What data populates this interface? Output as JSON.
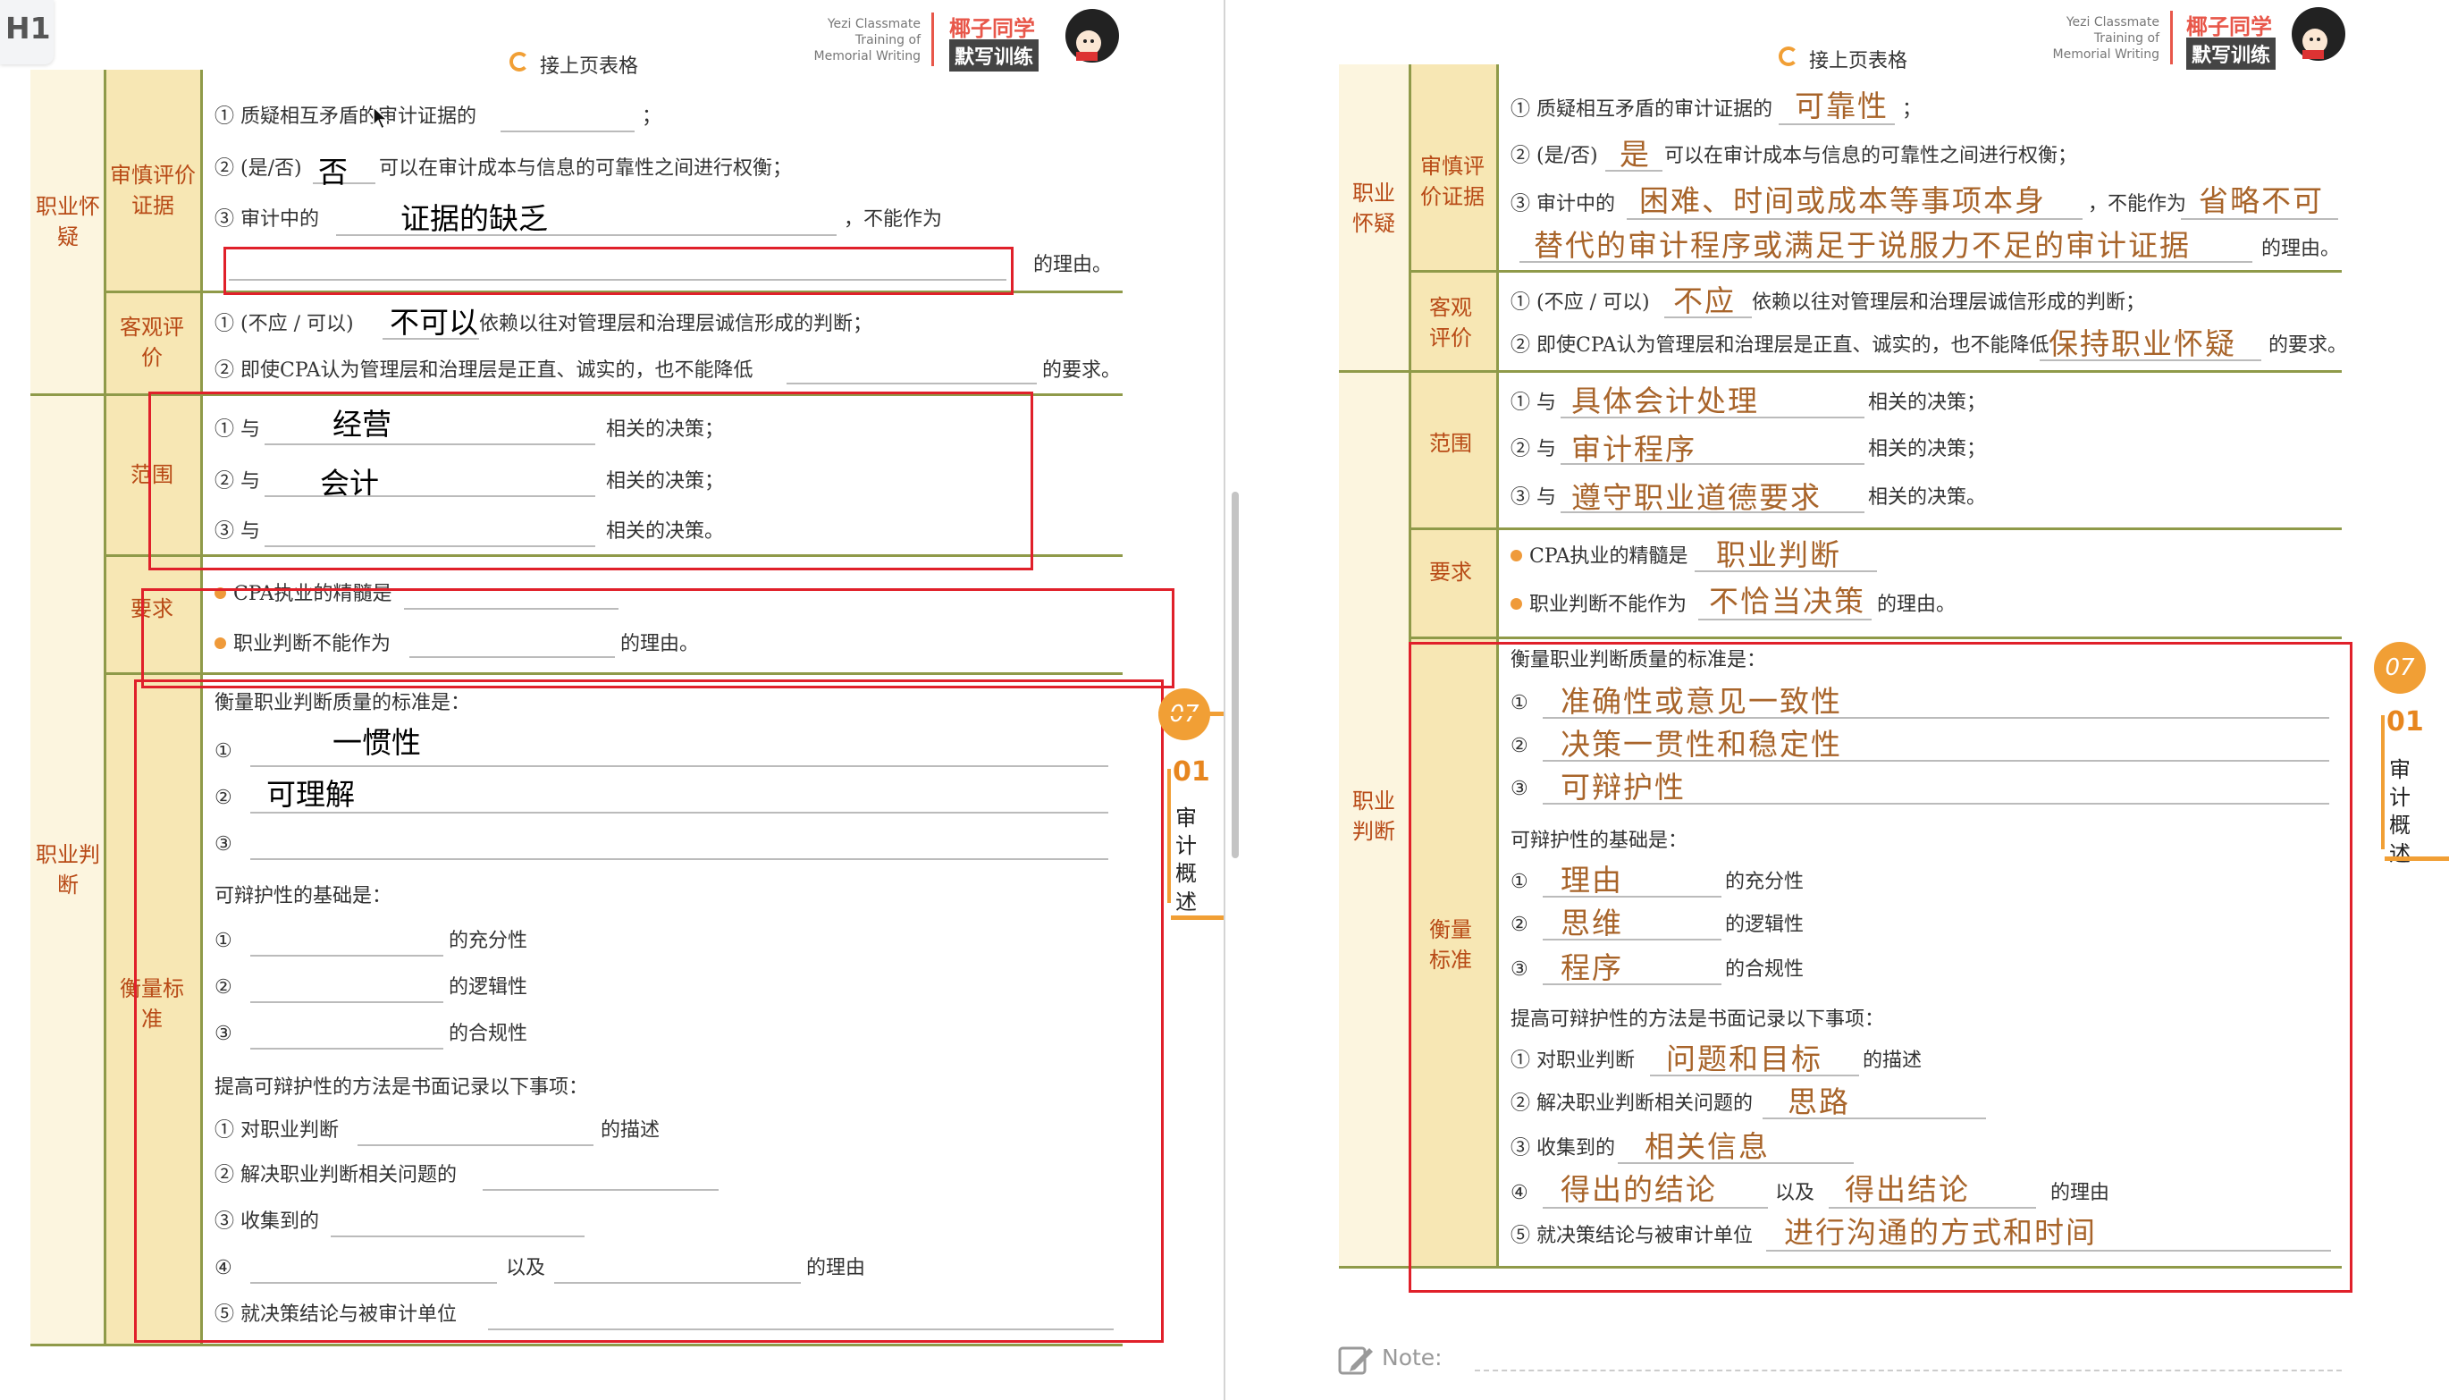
{
  "tag": "H1",
  "header": {
    "brand_en": [
      "Yezi Classmate",
      "Training of",
      "Memorial Writing"
    ],
    "brand_cn_top": "椰子同学",
    "brand_cn_bottom": "默写训练",
    "continue_label": "接上页表格",
    "note_label": "Note:"
  },
  "sidebar_tab": {
    "number": "07",
    "sub": "01",
    "chars": [
      "审",
      "计",
      "概",
      "述"
    ]
  },
  "sections": {
    "prof_skepticism": "职业怀疑",
    "prudent_eval": "审慎评价证据",
    "objective_eval": "客观评价",
    "scope": "范围",
    "requirement": "要求",
    "prof_judgment": "职业判断",
    "measure_std": "衡量标准"
  },
  "left": {
    "q1_prefix": "① 质疑相互矛盾的审计证据的",
    "q1_suffix": "；",
    "q2_prefix": "② (是/否)",
    "q2_answer": "否",
    "q2_suffix": "可以在审计成本与信息的可靠性之间进行权衡；",
    "q3_prefix": "③ 审计中的",
    "q3_answer": "证据的缺乏",
    "q3_mid": "，不能作为",
    "q3_suffix": "的理由。",
    "obj1_prefix": "① (不应 / 可以)",
    "obj1_answer": "不可以",
    "obj1_suffix": "依赖以往对管理层和治理层诚信形成的判断；",
    "obj2_prefix": "② 即使CPA认为管理层和治理层是正直、诚实的，也不能降低",
    "obj2_suffix": "的要求。",
    "scope1_prefix": "① 与",
    "scope1_answer": "经营",
    "scope1_suffix": "相关的决策；",
    "scope2_prefix": "② 与",
    "scope2_answer": "会计",
    "scope2_suffix": "相关的决策；",
    "scope3_prefix": "③ 与",
    "scope3_suffix": "相关的决策。",
    "req1": "CPA执业的精髓是",
    "req2_prefix": "职业判断不能作为",
    "req2_suffix": "的理由。",
    "std_title": "衡量职业判断质量的标准是：",
    "std1_num": "①",
    "std1_answer": "一惯性",
    "std2_num": "②",
    "std2_answer": "可理解",
    "std3_num": "③",
    "def_title": "可辩护性的基础是：",
    "def1_num": "①",
    "def1_suffix": "的充分性",
    "def2_num": "②",
    "def2_suffix": "的逻辑性",
    "def3_num": "③",
    "def3_suffix": "的合规性",
    "rec_title": "提高可辩护性的方法是书面记录以下事项：",
    "rec1_prefix": "① 对职业判断",
    "rec1_suffix": "的描述",
    "rec2_prefix": "② 解决职业判断相关问题的",
    "rec3_prefix": "③ 收集到的",
    "rec4_num": "④",
    "rec4_mid": "以及",
    "rec4_suffix": "的理由",
    "rec5_prefix": "⑤ 就决策结论与被审计单位"
  },
  "right": {
    "q1_prefix": "① 质疑相互矛盾的审计证据的",
    "q1_answer": "可靠性",
    "q1_suffix": "；",
    "q2_prefix": "② (是/否)",
    "q2_answer": "是",
    "q2_suffix": "可以在审计成本与信息的可靠性之间进行权衡；",
    "q3_prefix": "③ 审计中的",
    "q3_answer": "困难、时间或成本等事项本身",
    "q3_mid": "，不能作为",
    "q3_answer2": "省略不可",
    "q3_answer3": "替代的审计程序或满足于说服力不足的审计证据",
    "q3_suffix": "的理由。",
    "obj1_prefix": "① (不应 / 可以)",
    "obj1_answer": "不应",
    "obj1_suffix": "依赖以往对管理层和治理层诚信形成的判断；",
    "obj2_prefix": "② 即使CPA认为管理层和治理层是正直、诚实的，也不能降低",
    "obj2_answer": "保持职业怀疑",
    "obj2_suffix": "的要求。",
    "scope1_prefix": "① 与",
    "scope1_answer": "具体会计处理",
    "scope1_suffix": "相关的决策；",
    "scope2_prefix": "② 与",
    "scope2_answer": "审计程序",
    "scope2_suffix": "相关的决策；",
    "scope3_prefix": "③ 与",
    "scope3_answer": "遵守职业道德要求",
    "scope3_suffix": "相关的决策。",
    "req1": "CPA执业的精髓是",
    "req1_answer": "职业判断",
    "req2_prefix": "职业判断不能作为",
    "req2_answer": "不恰当决策",
    "req2_suffix": "的理由。",
    "std_title": "衡量职业判断质量的标准是：",
    "std1_num": "①",
    "std1_answer": "准确性或意见一致性",
    "std2_num": "②",
    "std2_answer": "决策一贯性和稳定性",
    "std3_num": "③",
    "std3_answer": "可辩护性",
    "def_title": "可辩护性的基础是：",
    "def1_num": "①",
    "def1_answer": "理由",
    "def1_suffix": "的充分性",
    "def2_num": "②",
    "def2_answer": "思维",
    "def2_suffix": "的逻辑性",
    "def3_num": "③",
    "def3_answer": "程序",
    "def3_suffix": "的合规性",
    "rec_title": "提高可辩护性的方法是书面记录以下事项：",
    "rec1_prefix": "① 对职业判断",
    "rec1_answer": "问题和目标",
    "rec1_suffix": "的描述",
    "rec2_prefix": "② 解决职业判断相关问题的",
    "rec2_answer": "思路",
    "rec3_prefix": "③ 收集到的",
    "rec3_answer": "相关信息",
    "rec4_num": "④",
    "rec4_answer": "得出的结论",
    "rec4_mid": "以及",
    "rec4_answer2": "得出结论",
    "rec4_suffix": "的理由",
    "rec5_prefix": "⑤ 就决策结论与被审计单位",
    "rec5_answer": "进行沟通的方式和时间"
  },
  "colors": {
    "accent": "#f19f35",
    "section_text": "#b84a16",
    "highlight_box": "#e0202a",
    "handwriting": "#a8642a"
  }
}
